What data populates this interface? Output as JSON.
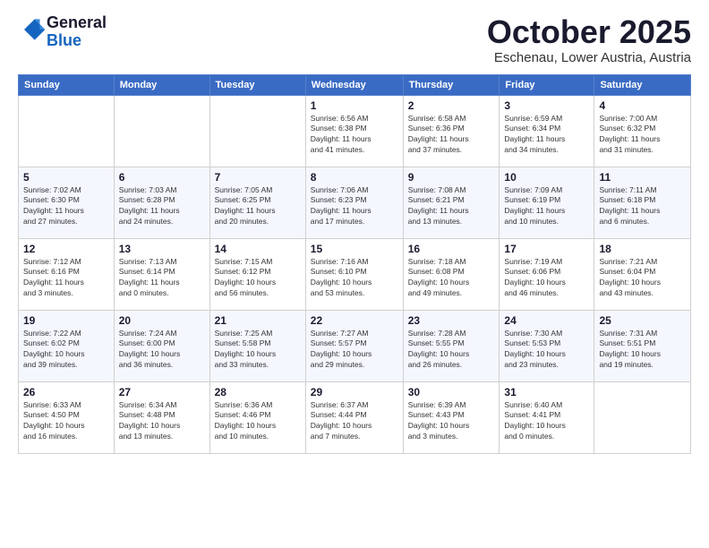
{
  "logo": {
    "general": "General",
    "blue": "Blue"
  },
  "header": {
    "month": "October 2025",
    "location": "Eschenau, Lower Austria, Austria"
  },
  "weekdays": [
    "Sunday",
    "Monday",
    "Tuesday",
    "Wednesday",
    "Thursday",
    "Friday",
    "Saturday"
  ],
  "weeks": [
    [
      {
        "day": "",
        "info": ""
      },
      {
        "day": "",
        "info": ""
      },
      {
        "day": "",
        "info": ""
      },
      {
        "day": "1",
        "info": "Sunrise: 6:56 AM\nSunset: 6:38 PM\nDaylight: 11 hours\nand 41 minutes."
      },
      {
        "day": "2",
        "info": "Sunrise: 6:58 AM\nSunset: 6:36 PM\nDaylight: 11 hours\nand 37 minutes."
      },
      {
        "day": "3",
        "info": "Sunrise: 6:59 AM\nSunset: 6:34 PM\nDaylight: 11 hours\nand 34 minutes."
      },
      {
        "day": "4",
        "info": "Sunrise: 7:00 AM\nSunset: 6:32 PM\nDaylight: 11 hours\nand 31 minutes."
      }
    ],
    [
      {
        "day": "5",
        "info": "Sunrise: 7:02 AM\nSunset: 6:30 PM\nDaylight: 11 hours\nand 27 minutes."
      },
      {
        "day": "6",
        "info": "Sunrise: 7:03 AM\nSunset: 6:28 PM\nDaylight: 11 hours\nand 24 minutes."
      },
      {
        "day": "7",
        "info": "Sunrise: 7:05 AM\nSunset: 6:25 PM\nDaylight: 11 hours\nand 20 minutes."
      },
      {
        "day": "8",
        "info": "Sunrise: 7:06 AM\nSunset: 6:23 PM\nDaylight: 11 hours\nand 17 minutes."
      },
      {
        "day": "9",
        "info": "Sunrise: 7:08 AM\nSunset: 6:21 PM\nDaylight: 11 hours\nand 13 minutes."
      },
      {
        "day": "10",
        "info": "Sunrise: 7:09 AM\nSunset: 6:19 PM\nDaylight: 11 hours\nand 10 minutes."
      },
      {
        "day": "11",
        "info": "Sunrise: 7:11 AM\nSunset: 6:18 PM\nDaylight: 11 hours\nand 6 minutes."
      }
    ],
    [
      {
        "day": "12",
        "info": "Sunrise: 7:12 AM\nSunset: 6:16 PM\nDaylight: 11 hours\nand 3 minutes."
      },
      {
        "day": "13",
        "info": "Sunrise: 7:13 AM\nSunset: 6:14 PM\nDaylight: 11 hours\nand 0 minutes."
      },
      {
        "day": "14",
        "info": "Sunrise: 7:15 AM\nSunset: 6:12 PM\nDaylight: 10 hours\nand 56 minutes."
      },
      {
        "day": "15",
        "info": "Sunrise: 7:16 AM\nSunset: 6:10 PM\nDaylight: 10 hours\nand 53 minutes."
      },
      {
        "day": "16",
        "info": "Sunrise: 7:18 AM\nSunset: 6:08 PM\nDaylight: 10 hours\nand 49 minutes."
      },
      {
        "day": "17",
        "info": "Sunrise: 7:19 AM\nSunset: 6:06 PM\nDaylight: 10 hours\nand 46 minutes."
      },
      {
        "day": "18",
        "info": "Sunrise: 7:21 AM\nSunset: 6:04 PM\nDaylight: 10 hours\nand 43 minutes."
      }
    ],
    [
      {
        "day": "19",
        "info": "Sunrise: 7:22 AM\nSunset: 6:02 PM\nDaylight: 10 hours\nand 39 minutes."
      },
      {
        "day": "20",
        "info": "Sunrise: 7:24 AM\nSunset: 6:00 PM\nDaylight: 10 hours\nand 36 minutes."
      },
      {
        "day": "21",
        "info": "Sunrise: 7:25 AM\nSunset: 5:58 PM\nDaylight: 10 hours\nand 33 minutes."
      },
      {
        "day": "22",
        "info": "Sunrise: 7:27 AM\nSunset: 5:57 PM\nDaylight: 10 hours\nand 29 minutes."
      },
      {
        "day": "23",
        "info": "Sunrise: 7:28 AM\nSunset: 5:55 PM\nDaylight: 10 hours\nand 26 minutes."
      },
      {
        "day": "24",
        "info": "Sunrise: 7:30 AM\nSunset: 5:53 PM\nDaylight: 10 hours\nand 23 minutes."
      },
      {
        "day": "25",
        "info": "Sunrise: 7:31 AM\nSunset: 5:51 PM\nDaylight: 10 hours\nand 19 minutes."
      }
    ],
    [
      {
        "day": "26",
        "info": "Sunrise: 6:33 AM\nSunset: 4:50 PM\nDaylight: 10 hours\nand 16 minutes."
      },
      {
        "day": "27",
        "info": "Sunrise: 6:34 AM\nSunset: 4:48 PM\nDaylight: 10 hours\nand 13 minutes."
      },
      {
        "day": "28",
        "info": "Sunrise: 6:36 AM\nSunset: 4:46 PM\nDaylight: 10 hours\nand 10 minutes."
      },
      {
        "day": "29",
        "info": "Sunrise: 6:37 AM\nSunset: 4:44 PM\nDaylight: 10 hours\nand 7 minutes."
      },
      {
        "day": "30",
        "info": "Sunrise: 6:39 AM\nSunset: 4:43 PM\nDaylight: 10 hours\nand 3 minutes."
      },
      {
        "day": "31",
        "info": "Sunrise: 6:40 AM\nSunset: 4:41 PM\nDaylight: 10 hours\nand 0 minutes."
      },
      {
        "day": "",
        "info": ""
      }
    ]
  ]
}
